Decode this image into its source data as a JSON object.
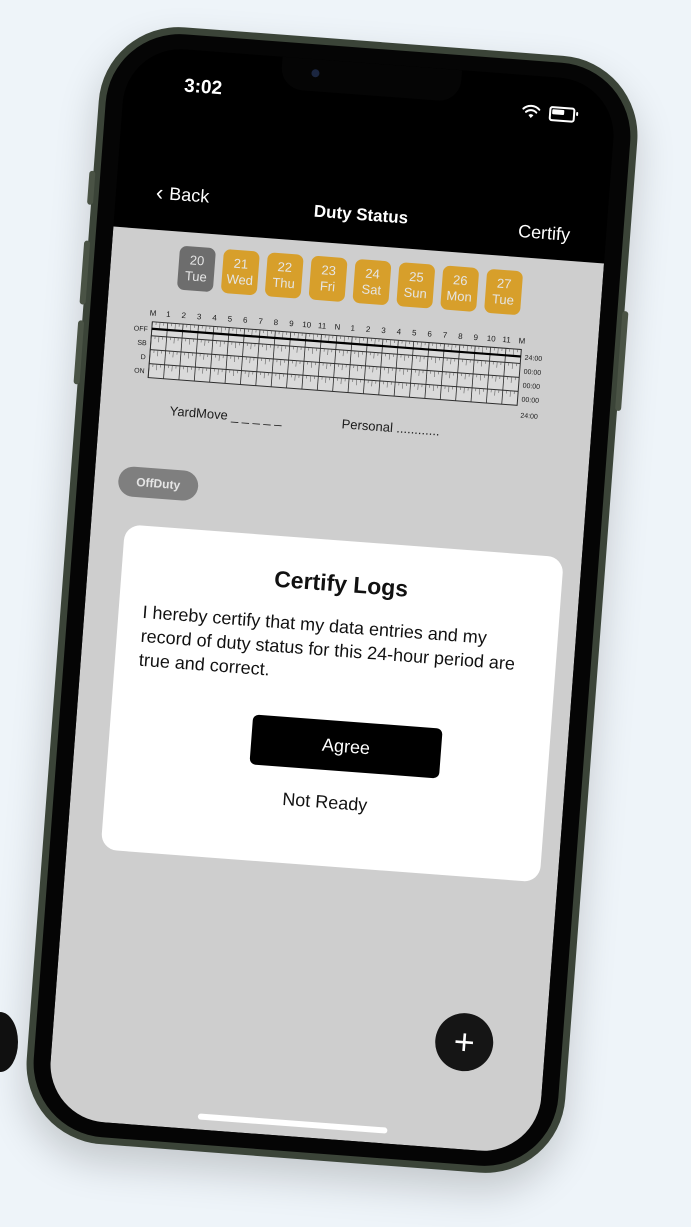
{
  "status_bar": {
    "time": "3:02"
  },
  "nav": {
    "back_label": "Back",
    "title": "Duty Status",
    "action_label": "Certify"
  },
  "days": [
    {
      "num": "20",
      "name": "Tue",
      "selected": true
    },
    {
      "num": "21",
      "name": "Wed",
      "selected": false
    },
    {
      "num": "22",
      "name": "Thu",
      "selected": false
    },
    {
      "num": "23",
      "name": "Fri",
      "selected": false
    },
    {
      "num": "24",
      "name": "Sat",
      "selected": false
    },
    {
      "num": "25",
      "name": "Sun",
      "selected": false
    },
    {
      "num": "26",
      "name": "Mon",
      "selected": false
    },
    {
      "num": "27",
      "name": "Tue",
      "selected": false
    }
  ],
  "log_grid": {
    "hour_labels": [
      "M",
      "1",
      "2",
      "3",
      "4",
      "5",
      "6",
      "7",
      "8",
      "9",
      "10",
      "11",
      "N",
      "1",
      "2",
      "3",
      "4",
      "5",
      "6",
      "7",
      "8",
      "9",
      "10",
      "11",
      "M"
    ],
    "row_labels": [
      "OFF",
      "SB",
      "D",
      "ON"
    ],
    "row_totals": [
      "24:00",
      "00:00",
      "00:00",
      "00:00"
    ],
    "grand_total": "24:00"
  },
  "legend": {
    "yard_move": "YardMove _ _ _ _ _",
    "personal": "Personal ............"
  },
  "status_chip": "OffDuty",
  "modal": {
    "title": "Certify Logs",
    "body": "I hereby certify that my data entries and my record of duty status for this 24-hour period are true and correct.",
    "agree_label": "Agree",
    "not_ready_label": "Not Ready"
  },
  "fab_symbol": "+",
  "colors": {
    "day_active": "#f0b230",
    "day_selected": "#7a7a7a",
    "frame": "#3b4438"
  }
}
